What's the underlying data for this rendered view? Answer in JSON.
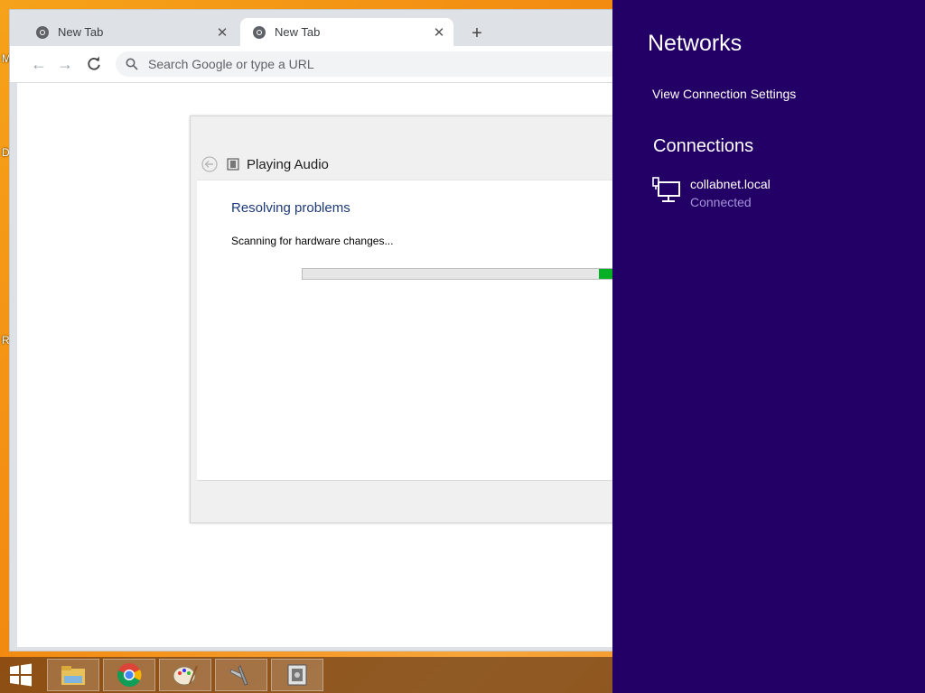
{
  "desktop": {
    "edge_letters": [
      "M",
      "D",
      "R"
    ]
  },
  "browser": {
    "tabs": [
      {
        "title": "New Tab",
        "active": false
      },
      {
        "title": "New Tab",
        "active": true
      }
    ],
    "new_tab_symbol": "+",
    "omnibox_placeholder": "Search Google or type a URL"
  },
  "troubleshooter": {
    "title": "Playing Audio",
    "heading": "Resolving problems",
    "status": "Scanning for hardware changes...",
    "progress_fraction": 0.05,
    "progress_color": "#06b025"
  },
  "taskbar": {
    "items": [
      "file-explorer-icon",
      "chrome-icon",
      "paint-icon",
      "tools-icon",
      "troubleshooter-icon"
    ]
  },
  "networks_panel": {
    "title": "Networks",
    "settings_link": "View Connection Settings",
    "section_title": "Connections",
    "connections": [
      {
        "name": "collabnet.local",
        "status": "Connected"
      }
    ],
    "background_color": "#220066"
  }
}
